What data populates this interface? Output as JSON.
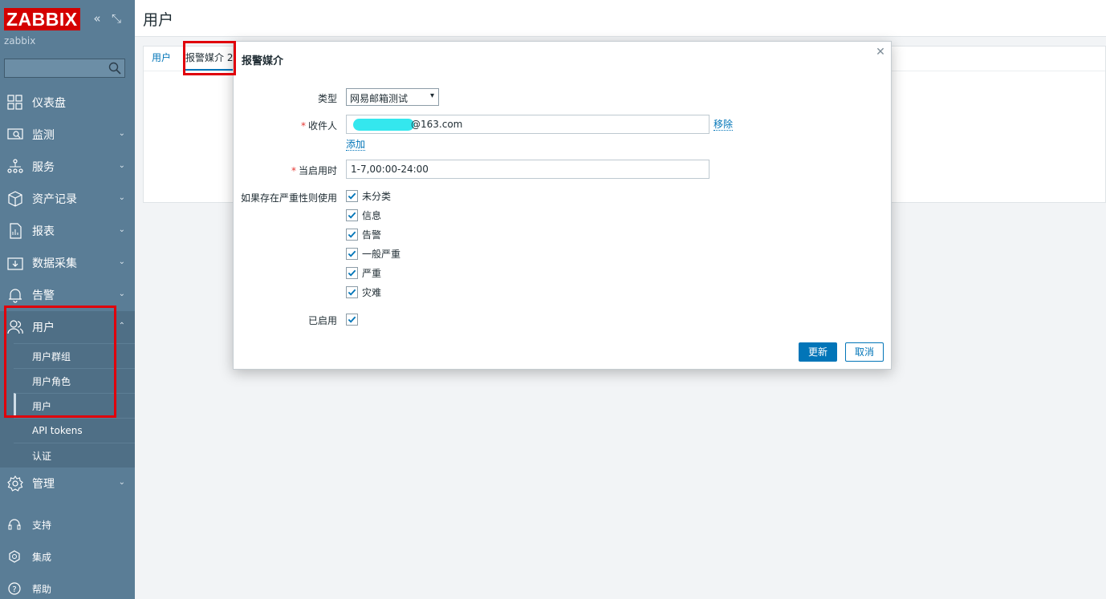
{
  "brand": {
    "logo": "ZABBIX",
    "server_name": "zabbix"
  },
  "sidebar": {
    "search_placeholder": "",
    "items": [
      {
        "label": "仪表盘",
        "icon": "dashboard-icon"
      },
      {
        "label": "监测",
        "icon": "monitoring-icon"
      },
      {
        "label": "服务",
        "icon": "services-icon"
      },
      {
        "label": "资产记录",
        "icon": "inventory-icon"
      },
      {
        "label": "报表",
        "icon": "reports-icon"
      },
      {
        "label": "数据采集",
        "icon": "data-collection-icon"
      },
      {
        "label": "告警",
        "icon": "alerts-icon"
      },
      {
        "label": "用户",
        "icon": "users-icon"
      }
    ],
    "sub_items": [
      "用户群组",
      "用户角色",
      "用户",
      "API tokens",
      "认证"
    ],
    "admin": {
      "label": "管理",
      "icon": "administration-icon"
    },
    "bottom": [
      {
        "label": "支持",
        "icon": "support-icon"
      },
      {
        "label": "集成",
        "icon": "integrations-icon"
      },
      {
        "label": "帮助",
        "icon": "help-icon"
      }
    ]
  },
  "page": {
    "title": "用户",
    "tabs": [
      "用户",
      "报警媒介 2"
    ]
  },
  "dialog": {
    "title": "报警媒介",
    "type_label": "类型",
    "type_value": "网易邮箱测试",
    "recipient_label": "收件人",
    "recipient_value": "@163.com",
    "remove_label": "移除",
    "add_label": "添加",
    "when_active_label": "当启用时",
    "when_active_value": "1-7,00:00-24:00",
    "severity_label": "如果存在严重性则使用",
    "severities": [
      "未分类",
      "信息",
      "告警",
      "一般严重",
      "严重",
      "灾难"
    ],
    "enabled_label": "已启用",
    "update_button": "更新",
    "cancel_button": "取消"
  },
  "colors": {
    "sidebar": "#5a7d96",
    "accent": "#0275b8",
    "logo": "#d40000",
    "highlight": "#e0000b"
  }
}
